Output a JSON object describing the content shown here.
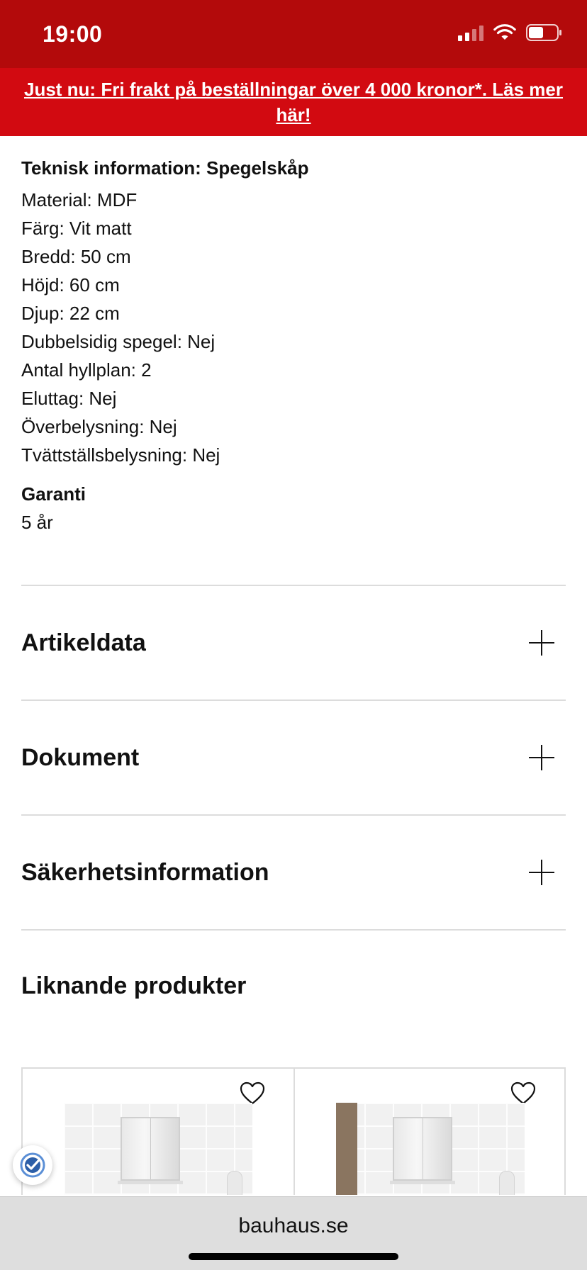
{
  "status_bar": {
    "time": "19:00"
  },
  "promo_banner": {
    "text": "Just nu: Fri frakt på beställningar över 4 000 kronor*. Läs mer här!"
  },
  "specs": {
    "heading": "Teknisk information: Spegelskåp",
    "items": [
      "Material: MDF",
      "Färg: Vit matt",
      "Bredd: 50 cm",
      "Höjd: 60 cm",
      "Djup: 22 cm",
      "Dubbelsidig spegel: Nej",
      "Antal hyllplan: 2",
      "Eluttag: Nej",
      "Överbelysning: Nej",
      "Tvättställsbelysning: Nej"
    ]
  },
  "warranty": {
    "heading": "Garanti",
    "value": "5 år"
  },
  "accordions": [
    {
      "title": "Artikeldata"
    },
    {
      "title": "Dokument"
    },
    {
      "title": "Säkerhetsinformation"
    }
  ],
  "similar_products": {
    "heading": "Liknande produkter"
  },
  "browser": {
    "url": "bauhaus.se"
  },
  "colors": {
    "status_bar_bg": "#b30a0b",
    "promo_bg": "#d20a11",
    "text": "#111111",
    "divider": "#dcdcdc",
    "url_bar_bg": "#dedede"
  },
  "icons": [
    "signal-icon",
    "wifi-icon",
    "battery-icon",
    "plus-icon",
    "heart-icon",
    "trust-badge-icon"
  ]
}
